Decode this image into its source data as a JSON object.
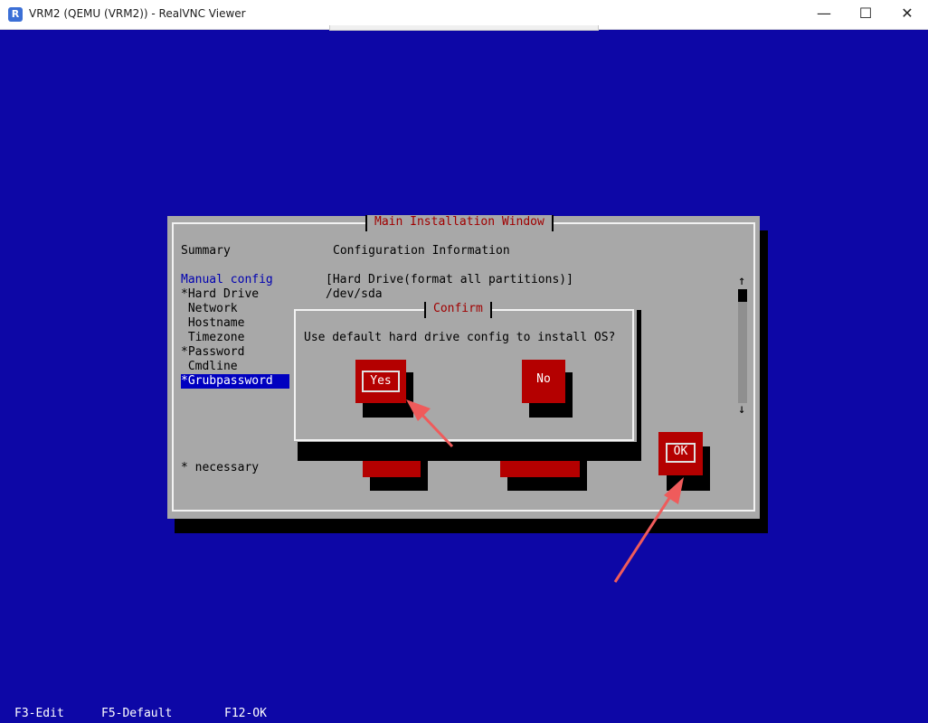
{
  "window": {
    "title": "VRM2 (QEMU (VRM2)) - RealVNC Viewer",
    "app_icon_glyph": "R",
    "controls": {
      "minimize": "—",
      "maximize": "☐",
      "close": "✕"
    }
  },
  "installer": {
    "title": "Main Installation Window",
    "summary_header": "Summary",
    "config_header": "Configuration Information",
    "menu_items": [
      {
        "label": "Manual config",
        "highlight": "blue"
      },
      {
        "label": "*Hard Drive"
      },
      {
        "label": " Network"
      },
      {
        "label": " Hostname"
      },
      {
        "label": " Timezone"
      },
      {
        "label": "*Password"
      },
      {
        "label": " Cmdline"
      },
      {
        "label": "*Grubpassword",
        "selected": true
      }
    ],
    "config_values": [
      "[Hard Drive(format all partitions)]",
      "/dev/sda"
    ],
    "footnote": "* necessary",
    "ok_label": "OK",
    "scroll_up": "↑",
    "scroll_down": "↓"
  },
  "confirm_dialog": {
    "title": "Confirm",
    "message": "Use default hard drive config to install OS?",
    "yes_label": "Yes",
    "no_label": "No"
  },
  "function_keys": [
    "F3-Edit",
    "F5-Default",
    "F12-OK"
  ],
  "colors": {
    "console_bg": "#0d07a6",
    "window_gray": "#a8a8a8",
    "button_red": "#b40000",
    "title_red": "#a00000",
    "annotation_arrow": "#ef5b5b"
  }
}
